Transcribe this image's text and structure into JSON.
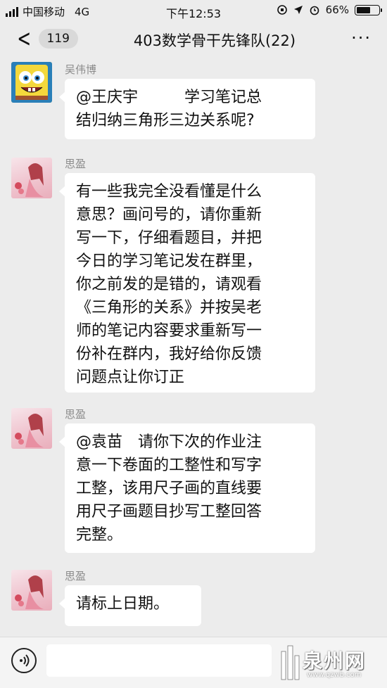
{
  "status_bar": {
    "carrier": "中国移动",
    "network": "4G",
    "time": "下午12:53",
    "battery": "66%",
    "battery_level": 0.66
  },
  "nav": {
    "unread_count": "119",
    "title": "403数学骨干先锋队(22)"
  },
  "messages": [
    {
      "sender": "吴伟博",
      "avatar": "spongebob-avatar",
      "lines": [
        "@王庆宇　　　学习笔记总",
        "结归纳三角形三边关系呢?"
      ]
    },
    {
      "sender": "思盈",
      "avatar": "girl-avatar",
      "lines": [
        "有一些我完全没看懂是什么",
        "意思？画问号的，请你重新",
        "写一下，仔细看题目，并把",
        "今日的学习笔记发在群里，",
        "你之前发的是错的，请观看",
        "《三角形的关系》并按吴老",
        "师的笔记内容要求重新写一",
        "份补在群内，我好给你反馈",
        "问题点让你订正"
      ]
    },
    {
      "sender": "思盈",
      "avatar": "girl-avatar",
      "lines": [
        "@袁苗　请你下次的作业注",
        "意一下卷面的工整性和写字",
        "工整，该用尺子画的直线要",
        "用尺子画题目抄写工整回答",
        "完整。"
      ]
    },
    {
      "sender": "思盈",
      "avatar": "girl-avatar",
      "lines": [
        "请标上日期。"
      ]
    }
  ],
  "watermark": {
    "text": "泉州网",
    "url": "www.qzwb.com"
  }
}
